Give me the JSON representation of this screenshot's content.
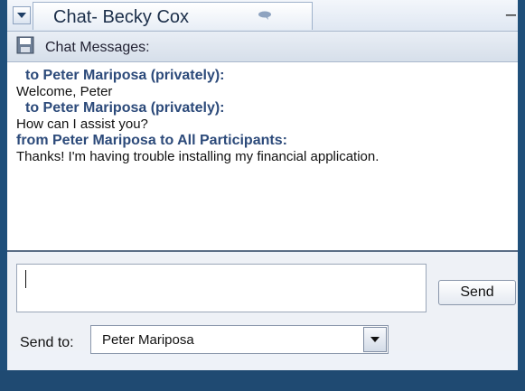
{
  "window": {
    "title": "Chat- Becky Cox",
    "close_symbol": "–"
  },
  "messages_panel": {
    "label": "Chat Messages:",
    "messages": [
      {
        "sender": "to Peter Mariposa  (privately):",
        "body": "Welcome, Peter"
      },
      {
        "sender": "to Peter Mariposa  (privately):",
        "body": "How can I assist you?"
      },
      {
        "sender": "from Peter Mariposa to All Participants:",
        "body": "Thanks!  I'm having trouble installing my financial application."
      }
    ]
  },
  "compose": {
    "input_value": "",
    "send_label": "Send",
    "send_to_label": "Send to:",
    "send_to_value": "Peter Mariposa"
  },
  "icons": {
    "collapse": "chevron-down-icon",
    "chat_bubble": "chat-bubble-icon",
    "save": "save-icon",
    "dropdown": "dropdown-arrow-icon"
  },
  "colors": {
    "sender_text": "#2c4a7a",
    "frame": "#1f4f7a"
  }
}
